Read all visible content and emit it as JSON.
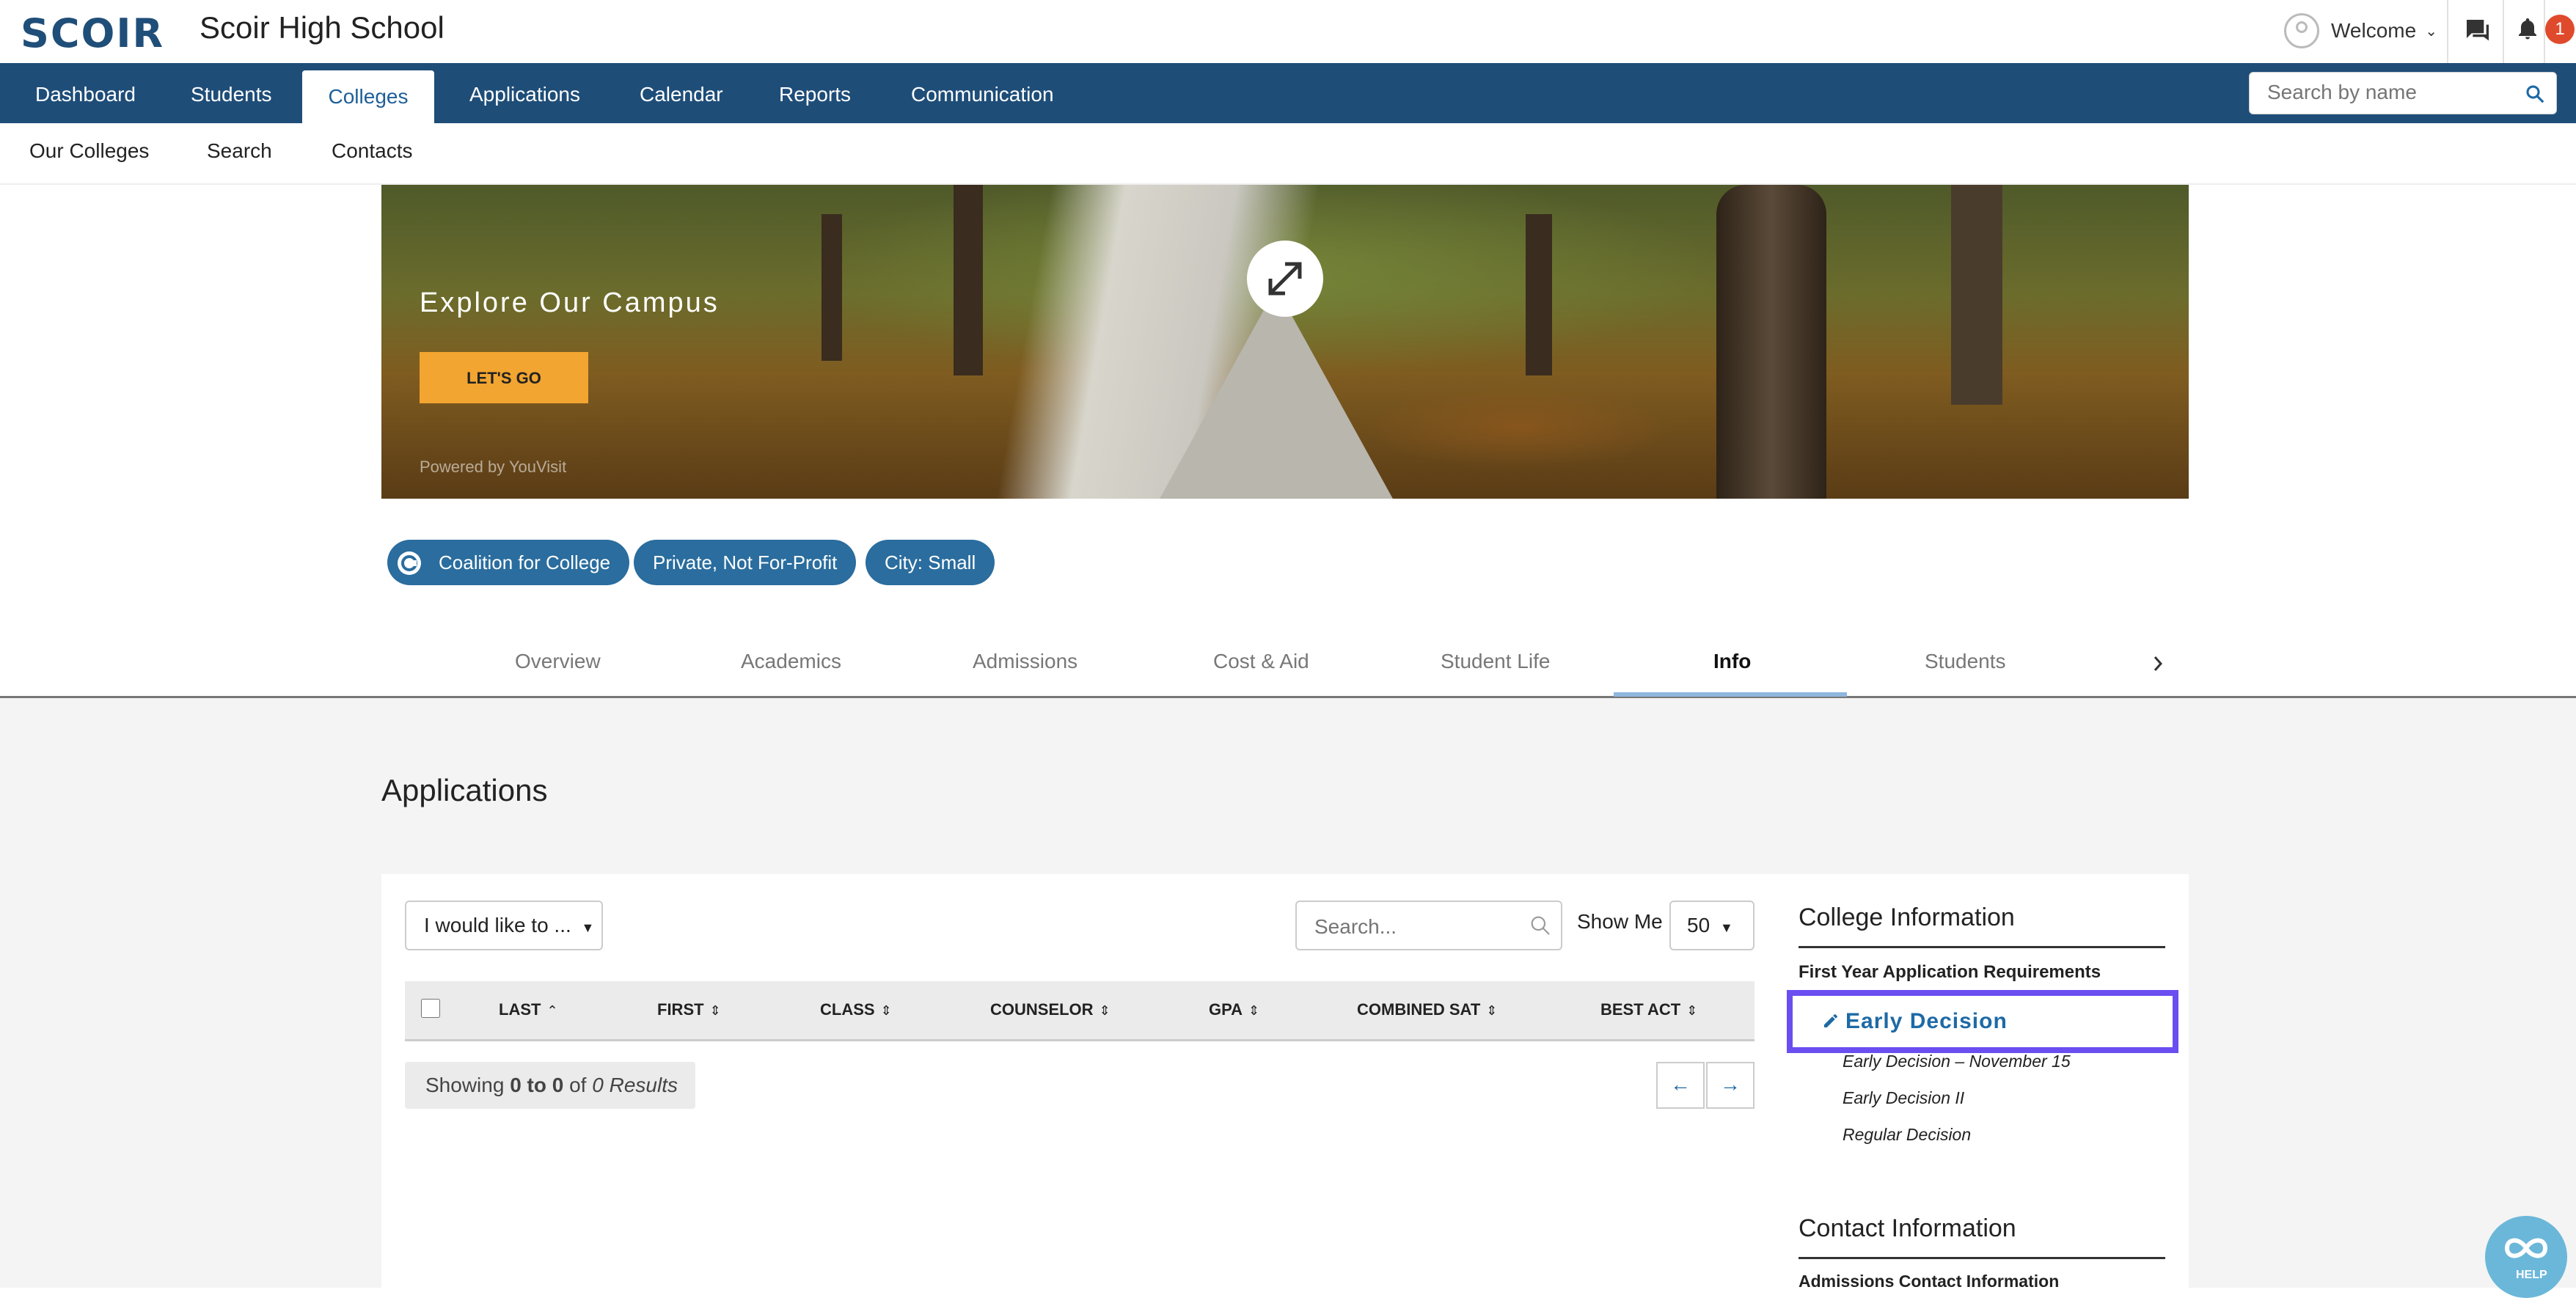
{
  "topbar": {
    "logo": "SCOIR",
    "school_name": "Scoir High School",
    "welcome": "Welcome",
    "notification_count": "1"
  },
  "main_nav": {
    "items": [
      "Dashboard",
      "Students",
      "Colleges",
      "Applications",
      "Calendar",
      "Reports",
      "Communication"
    ],
    "active": "Colleges",
    "search_placeholder": "Search by name"
  },
  "sub_nav": {
    "items": [
      "Our Colleges",
      "Search",
      "Contacts"
    ]
  },
  "hero": {
    "title": "Explore Our Campus",
    "button": "LET'S GO",
    "powered_by": "Powered by YouVisit"
  },
  "tags": [
    "Coalition for College",
    "Private, Not For-Profit",
    "City: Small"
  ],
  "tabs": {
    "items": [
      "Overview",
      "Academics",
      "Admissions",
      "Cost & Aid",
      "Student Life",
      "Info",
      "Students"
    ],
    "active": "Info"
  },
  "applications": {
    "title": "Applications",
    "action_select": "I would like to ...",
    "search_placeholder": "Search...",
    "show_me_label": "Show Me",
    "show_me_value": "50",
    "columns": [
      "LAST",
      "FIRST",
      "CLASS",
      "COUNSELOR",
      "GPA",
      "COMBINED SAT",
      "BEST ACT"
    ],
    "showing_prefix": "Showing",
    "showing_range": "0 to 0",
    "showing_of": "of",
    "showing_results": "0 Results",
    "prev": "←",
    "next": "→"
  },
  "college_info": {
    "title": "College Information",
    "requirements_heading": "First Year Application Requirements",
    "selected_plan": "Early Decision",
    "deadlines": [
      "Early Decision – November 15",
      "Early Decision II",
      "Regular Decision"
    ],
    "contact_title": "Contact Information",
    "contact_subheading": "Admissions Contact Information"
  },
  "help_label": "HELP",
  "colors": {
    "nav_bg": "#1e4d78",
    "accent": "#1e6aa6",
    "highlight": "#6a4ef0",
    "tag_bg": "#2a6d9e",
    "cta": "#f2a530"
  }
}
